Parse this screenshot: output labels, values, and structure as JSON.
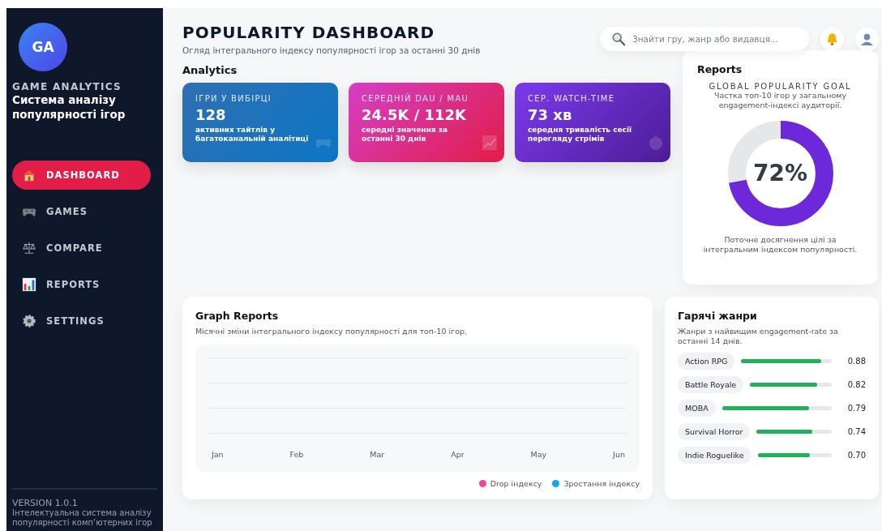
{
  "sidebar": {
    "logo": "GA",
    "brand": "GAME ANALYTICS",
    "subtitle": "Система аналізу популярності ігор",
    "items": [
      {
        "label": "DASHBOARD",
        "selected": true
      },
      {
        "label": "GAMES",
        "selected": false
      },
      {
        "label": "COMPARE",
        "selected": false
      },
      {
        "label": "REPORTS",
        "selected": false
      },
      {
        "label": "SETTINGS",
        "selected": false
      }
    ],
    "version": "VERSION 1.0.1",
    "footer": "Інтелектуальна система аналізу популярності комп’ютерних ігор"
  },
  "header": {
    "title": "POPULARITY DASHBOARD",
    "subtitle": "Огляд інтегрального індексу популярності ігор за останні 30 днів",
    "search": {
      "placeholder": "Знайти гру, жанр або видавця..."
    }
  },
  "analytics": {
    "title": "Analytics",
    "cards": [
      {
        "label": "ІГРИ У ВИБІРЦІ",
        "value": "128",
        "note": "активних тайтлів у багатоканальній аналітиці"
      },
      {
        "label": "СЕРЕДНІЙ DAU / MAU",
        "value": "24.5K / 112K",
        "note": "середні значення за останні 30 днів"
      },
      {
        "label": "СЕР. WATCH-TIME",
        "value": "73 хв",
        "note": "середня тривалість сесії перегляду стрімів"
      }
    ]
  },
  "reports": {
    "title": "Reports",
    "goal_title": "GLOBAL POPULARITY GOAL",
    "goal_text": "Частка топ-10 ігор у загальному engagement-індексі аудиторії.",
    "reading": "72%",
    "caption": "Поточне досягнення цілі за інтегральним індексом популярності."
  },
  "graph": {
    "title": "Graph Reports",
    "subtitle": "Місячні зміни інтегрального індексу популярності для топ-10 ігор.",
    "x_labels": [
      "Jan",
      "Feb",
      "Mar",
      "Apr",
      "May",
      "Jun"
    ],
    "legend": [
      {
        "label": "Drop індексу",
        "color": "#ec4899"
      },
      {
        "label": "Зростання індексу",
        "color": "#0ea5e9"
      }
    ]
  },
  "genres": {
    "title": "Гарячі жанри",
    "subtitle": "Жанри з найвищим engagement-rate за останні 14 днів.",
    "items": [
      {
        "name": "Action RPG",
        "level": 0.88,
        "reading": "0.88"
      },
      {
        "name": "Battle Royale",
        "level": 0.82,
        "reading": "0.82"
      },
      {
        "name": "MOBA",
        "level": 0.79,
        "reading": "0.79"
      },
      {
        "name": "Survival Horror",
        "level": 0.74,
        "reading": "0.74"
      },
      {
        "name": "Indie Roguelike",
        "level": 0.7,
        "reading": "0.70"
      }
    ]
  }
}
